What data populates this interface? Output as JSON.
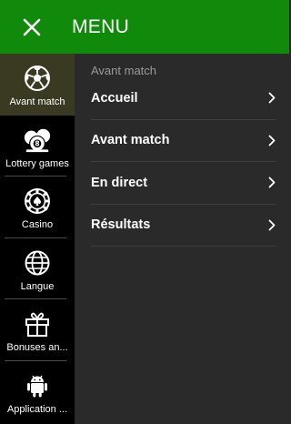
{
  "header": {
    "title": "MENU",
    "close_icon": "close-icon",
    "background_color": "#118a0c"
  },
  "sidebar": {
    "items": [
      {
        "label": "Avant match",
        "icon": "soccer-ball-icon",
        "active": true
      },
      {
        "label": "Lottery games",
        "icon": "lottery-balls-icon",
        "active": false
      },
      {
        "label": "Casino",
        "icon": "casino-chip-icon",
        "active": false
      },
      {
        "label": "Langue",
        "icon": "globe-icon",
        "active": false
      },
      {
        "label": "Bonuses an...",
        "icon": "gift-icon",
        "active": false
      },
      {
        "label": "Application ...",
        "icon": "android-icon",
        "active": false
      }
    ]
  },
  "main": {
    "section_title": "Avant match",
    "items": [
      {
        "label": "Accueil",
        "icon": "chevron-right-icon"
      },
      {
        "label": "Avant match",
        "icon": "chevron-right-icon"
      },
      {
        "label": "En direct",
        "icon": "chevron-right-icon"
      },
      {
        "label": "Résultats",
        "icon": "chevron-right-icon"
      }
    ]
  }
}
